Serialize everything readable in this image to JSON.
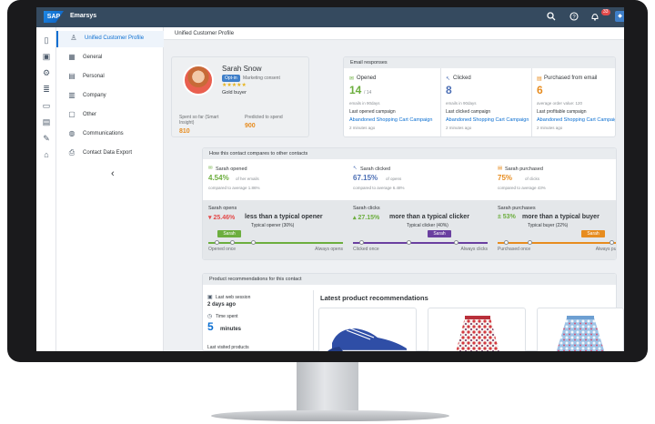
{
  "header": {
    "logo": "SAP",
    "brand": "Emarsys",
    "icons": [
      "search-icon",
      "help-icon",
      "bell-icon",
      "profile-icon"
    ],
    "notifications": "33"
  },
  "rail": [
    "file-icon",
    "image-icon",
    "settings-icon",
    "list-icon",
    "devices-icon",
    "table-icon",
    "wrench-icon",
    "home-icon"
  ],
  "nav": {
    "items": [
      {
        "label": "Unified Customer Profile",
        "icon": "person-icon",
        "active": true
      },
      {
        "label": "General",
        "icon": "grid-icon"
      },
      {
        "label": "Personal",
        "icon": "id-card-icon"
      },
      {
        "label": "Company",
        "icon": "building-icon"
      },
      {
        "label": "Other",
        "icon": "document-icon"
      },
      {
        "label": "Communications",
        "icon": "globe-icon"
      },
      {
        "label": "Contact Data Export",
        "icon": "export-icon"
      }
    ],
    "collapse": "‹"
  },
  "page": {
    "title": "Unified Customer Profile"
  },
  "profile": {
    "name": "Sarah Snow",
    "badge": "Opt-in",
    "subtitle": "Marketing consent",
    "stars": "★★★★★",
    "tier": "Gold buyer",
    "spent_label": "Spent so far (Smart Insight)",
    "spent_value": "810",
    "predicted_label": "Predicted to spend",
    "predicted_value": "900"
  },
  "email": {
    "title": "Email responses",
    "cols": [
      {
        "label": "Opened",
        "value": "14",
        "unit": "/ 14",
        "sub": "emails in 90days",
        "last_label": "Last opened campaign",
        "campaign": "Abandoned Shopping Cart Campaign",
        "ago": "2 minutes ago",
        "icon": "mail-open-icon",
        "color": "#6cae3e"
      },
      {
        "label": "Clicked",
        "value": "8",
        "unit": "",
        "sub": "emails in 90days",
        "last_label": "Last clicked campaign",
        "campaign": "Abandoned Shopping Cart Campaign",
        "ago": "2 minutes ago",
        "icon": "cursor-icon",
        "color": "#4c6fb5"
      },
      {
        "label": "Purchased from email",
        "value": "6",
        "unit": "",
        "sub": "average order value: 120",
        "last_label": "Last profitable campaign",
        "campaign": "Abandoned Shopping Cart Campaign",
        "ago": "2 minutes ago",
        "icon": "cart-icon",
        "color": "#e78c1f"
      }
    ]
  },
  "compare": {
    "title": "How this contact compares to other contacts",
    "stats": [
      {
        "label": "Sarah opened",
        "value": "4.54%",
        "sub": "of her emails",
        "note": "compared to average 1.86%",
        "color": "#6cae3e",
        "icon": "mail-open-icon"
      },
      {
        "label": "Sarah clicked",
        "value": "67.15%",
        "sub": "of opens",
        "note": "compared to average 6.48%",
        "color": "#4c6fb5",
        "icon": "cursor-icon"
      },
      {
        "label": "Sarah purchased",
        "value": "75%",
        "sub": "of clicks",
        "note": "compared to average 43%",
        "color": "#e78c1f",
        "icon": "cart-icon"
      }
    ],
    "bars": [
      {
        "label": "Sarah opens",
        "pct": "▾ 25.46%",
        "text": "less than a typical opener",
        "typical": "Typical opener (30%)",
        "pill": "Sarah",
        "left": "Opened once",
        "right": "Always opens",
        "color": "#6cae3e",
        "pill_color": "#6cae3e",
        "pct_color": "#e34b4b",
        "marker": 0.08,
        "typical_pos": 0.32
      },
      {
        "label": "Sarah clicks",
        "pct": "▴ 27.15%",
        "text": "more than a typical clicker",
        "typical": "Typical clicker (40%)",
        "pill": "Sarah",
        "left": "Clicked once",
        "right": "Always clicks",
        "color": "#6a3fa0",
        "pill_color": "#6a3fa0",
        "pct_color": "#6cae3e",
        "marker": 0.67,
        "typical_pos": 0.4
      },
      {
        "label": "Sarah purchases",
        "pct": "± 53%",
        "text": "more than a typical buyer",
        "typical": "Typical buyer (22%)",
        "pill": "Sarah",
        "left": "Purchased once",
        "right": "Always purchases",
        "color": "#e78c1f",
        "pill_color": "#e78c1f",
        "pct_color": "#6cae3e",
        "marker": 0.75,
        "typical_pos": 0.22
      }
    ]
  },
  "recs": {
    "title": "Product recommendations for this contact",
    "last_session_label": "Last web session",
    "last_session_value": "2 days ago",
    "time_label": "Time spent",
    "time_value": "5",
    "time_unit": "minutes",
    "last_visited": "Last visited products",
    "latest_title": "Latest product recommendations"
  }
}
